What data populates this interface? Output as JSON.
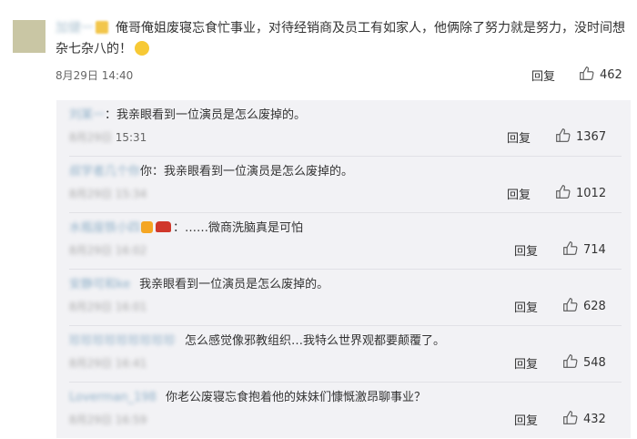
{
  "main_comment": {
    "username": "加健一",
    "text": "俺哥俺姐废寝忘食忙事业，对待经销商及员工有如家人，他俩除了努力就是努力，没时间想杂七杂八的！",
    "time": "8月29日 14:40",
    "reply_label": "回复",
    "likes": "462"
  },
  "replies": [
    {
      "username": "刘某一",
      "sep": "：",
      "text": "我亲眼看到一位演员是怎么废掉的。",
      "time_blur": "8月29日",
      "time": "15:31",
      "reply_label": "回复",
      "likes": "1367"
    },
    {
      "username": "叔学者几个你",
      "sep": "你：",
      "text": "我亲眼看到一位演员是怎么废掉的。",
      "time_blur": "8月29日 15:34",
      "time": "",
      "reply_label": "回复",
      "likes": "1012"
    },
    {
      "username": "水瓶座铁小四",
      "sep": "：",
      "text": "……微商洗脑真是可怕",
      "time_blur": "8月29日 16:02",
      "time": "",
      "reply_label": "回复",
      "likes": "714"
    },
    {
      "username": "安静可和ke",
      "sep": "",
      "text": "我亲眼看到一位演员是怎么废掉的。",
      "time_blur": "8月29日 16:01",
      "time": "",
      "reply_label": "回复",
      "likes": "628"
    },
    {
      "username": "珍珍珍珍珍珍珍珍珍",
      "sep": "",
      "text": "怎么感觉像邪教组织…我特么世界观都要颠覆了。",
      "time_blur": "8月29日 16:41",
      "time": "",
      "reply_label": "回复",
      "likes": "548"
    },
    {
      "username": "Loverman_198",
      "sep": "",
      "text": "你老公废寝忘食抱着他的妹妹们慷慨激昂聊事业？",
      "time_blur": "8月29日 16:59",
      "time": "",
      "reply_label": "回复",
      "likes": "432"
    }
  ],
  "colors": {
    "accent_name": "#8fb0c8",
    "reply_bg": "#f2f2f5",
    "text": "#333333"
  },
  "icons": {
    "like": "thumbs-up-icon",
    "emoji": "laughing-crying-emoji-icon"
  }
}
